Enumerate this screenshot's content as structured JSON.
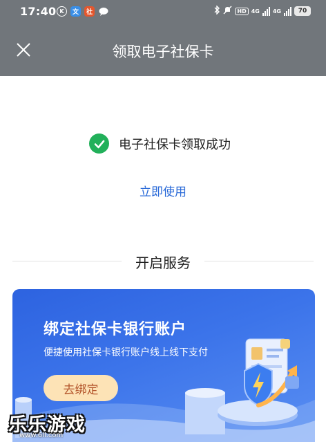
{
  "status_bar": {
    "time": "17:40",
    "app_icons": [
      {
        "icon": "k-circle-icon",
        "glyph": "Ⓚ",
        "bg": "#71767b",
        "fg": "#ffffff"
      },
      {
        "icon": "wen-app-icon",
        "glyph": "文",
        "bg": "#3a8ee6",
        "fg": "#ffffff"
      },
      {
        "icon": "social-security-app-icon",
        "glyph": "社",
        "bg": "#e4572e",
        "fg": "#ffffff"
      },
      {
        "icon": "chat-bubble-icon",
        "glyph": "●",
        "bg": "#71767b",
        "fg": "#ffffff"
      }
    ],
    "hd_label": "HD",
    "network_label_1": "4G",
    "network_label_2": "4G",
    "battery": "70"
  },
  "header": {
    "title": "领取电子社保卡",
    "close_icon": "close-icon",
    "bg_color": "#71767b"
  },
  "success": {
    "icon": "check-circle-icon",
    "message": "电子社保卡领取成功",
    "icon_color": "#22b05a"
  },
  "use_link": "立即使用",
  "section": {
    "title": "开启服务"
  },
  "banner": {
    "title": "绑定社保卡银行账户",
    "subtitle": "便捷使用社保卡银行账户线上线下支付",
    "button_label": "去绑定",
    "accent_color": "#2d63e0"
  },
  "watermark": {
    "text": "乐乐游戏",
    "url": "www.6ll.com"
  }
}
